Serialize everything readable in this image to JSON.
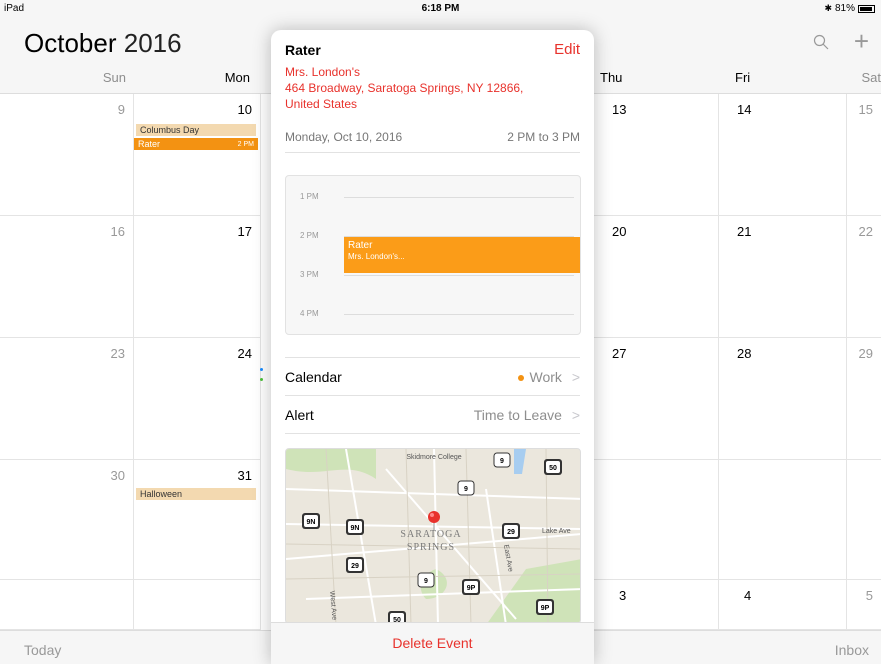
{
  "status": {
    "device": "iPad",
    "time": "6:18 PM",
    "battery": "81%"
  },
  "header": {
    "month": "October",
    "year": "2016",
    "search_icon": "search-icon",
    "add_icon": "plus-icon"
  },
  "weekdays": [
    "Sun",
    "Mon",
    "Thu",
    "Fri",
    "Sat"
  ],
  "days": {
    "r1": [
      "9",
      "10",
      "13",
      "14",
      "15"
    ],
    "r2": [
      "16",
      "17",
      "20",
      "21",
      "22"
    ],
    "r3": [
      "23",
      "24",
      "27",
      "28",
      "29"
    ],
    "r4": [
      "30",
      "31"
    ],
    "r5": [
      "3",
      "4",
      "5"
    ]
  },
  "events": {
    "columbus": "Columbus Day",
    "rater": "Rater",
    "rater_time": "2 PM",
    "halloween": "Halloween"
  },
  "toolbar": {
    "today": "Today",
    "inbox": "Inbox"
  },
  "popover": {
    "title": "Rater",
    "edit": "Edit",
    "location_1": "Mrs. London's",
    "location_2": "464 Broadway, Saratoga Springs, NY  12866,",
    "location_3": "United States",
    "date": "Monday, Oct 10, 2016",
    "time": "2 PM to 3 PM",
    "timeline": {
      "labels": [
        "1 PM",
        "2 PM",
        "3 PM",
        "4 PM"
      ],
      "event_title": "Rater",
      "event_sub": "Mrs. London's..."
    },
    "calendar_label": "Calendar",
    "calendar_value": "Work",
    "alert_label": "Alert",
    "alert_value": "Time to Leave",
    "map": {
      "college": "Skidmore College",
      "city_1": "SARATOGA",
      "city_2": "SPRINGS",
      "road_lake": "Lake Ave",
      "road_east": "East Ave",
      "road_west": "West Ave",
      "shields": [
        "9",
        "50",
        "9",
        "9N",
        "9N",
        "29",
        "29",
        "9",
        "9P",
        "9P",
        "50"
      ]
    },
    "delete": "Delete Event"
  },
  "colors": {
    "accent": "#e8322c",
    "event": "#f39212"
  }
}
